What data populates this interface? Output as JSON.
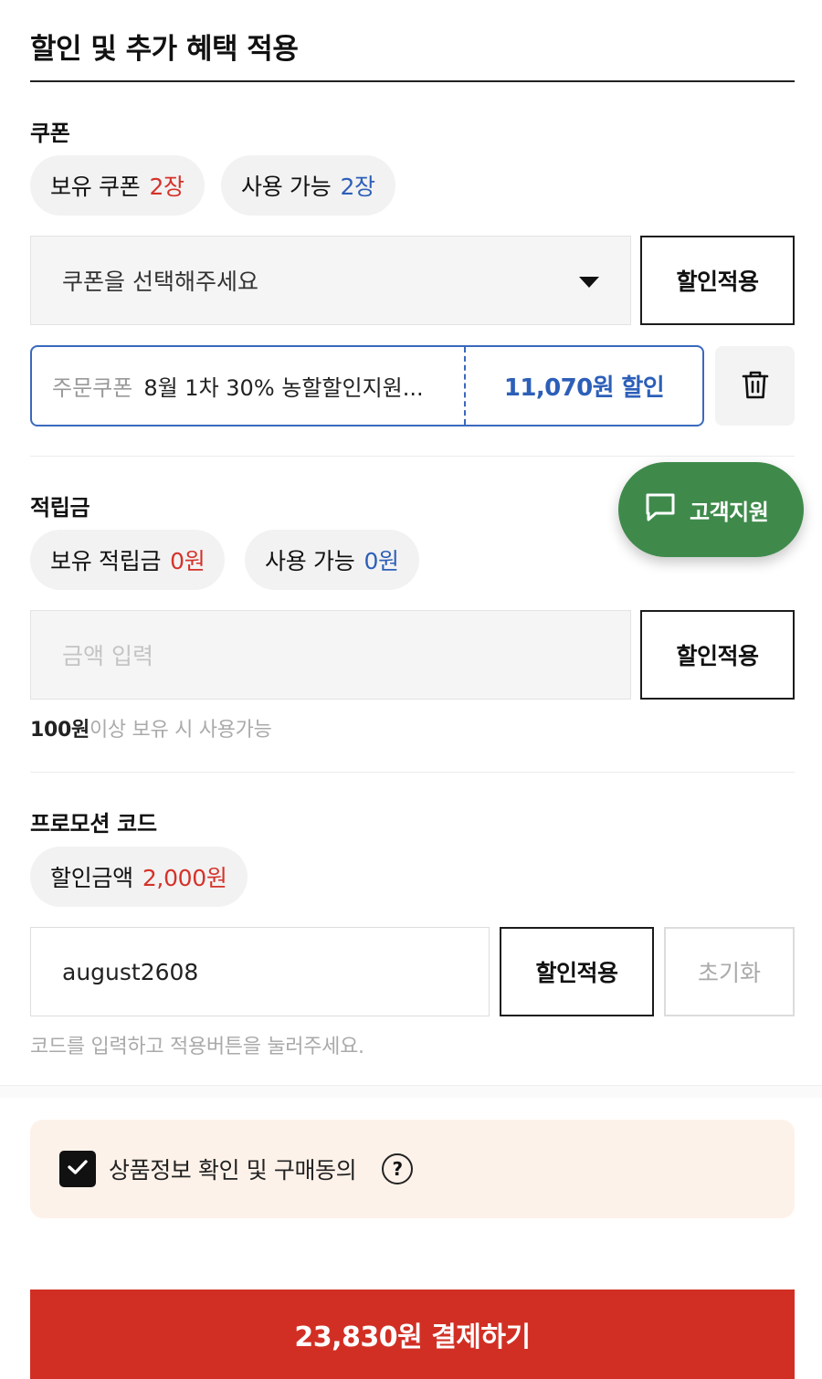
{
  "page": {
    "title": "할인 및 추가 혜택 적용"
  },
  "coupon": {
    "section_label": "쿠폰",
    "owned_label": "보유 쿠폰",
    "owned_value": "2장",
    "usable_label": "사용 가능",
    "usable_value": "2장",
    "select_placeholder": "쿠폰을 선택해주세요",
    "apply_label": "할인적용",
    "applied": {
      "kind": "주문쿠폰",
      "name": "8월 1차 30% 농할할인지원...",
      "discount": "11,070원 할인"
    }
  },
  "points": {
    "section_label": "적립금",
    "owned_label": "보유 적립금",
    "owned_value": "0원",
    "usable_label": "사용 가능",
    "usable_value": "0원",
    "input_placeholder": "금액 입력",
    "apply_label": "할인적용",
    "hint_bold": "100원",
    "hint_rest": "이상 보유 시 사용가능"
  },
  "promo": {
    "section_label": "프로모션 코드",
    "discount_label": "할인금액",
    "discount_value": "2,000원",
    "input_value": "august2608",
    "apply_label": "할인적용",
    "reset_label": "초기화",
    "hint": "코드를 입력하고 적용버튼을 눌러주세요."
  },
  "support": {
    "label": "고객지원"
  },
  "agreement": {
    "label": "상품정보 확인 및 구매동의",
    "checked": true,
    "help": "?"
  },
  "payment": {
    "button_label": "23,830원 결제하기"
  },
  "colors": {
    "accent_red": "#d22f24",
    "accent_blue": "#2d5fb8",
    "support_green": "#3f8a4b"
  },
  "icons": [
    "chevron-down-icon",
    "trash-icon",
    "chat-icon",
    "checkmark-icon",
    "question-icon"
  ]
}
